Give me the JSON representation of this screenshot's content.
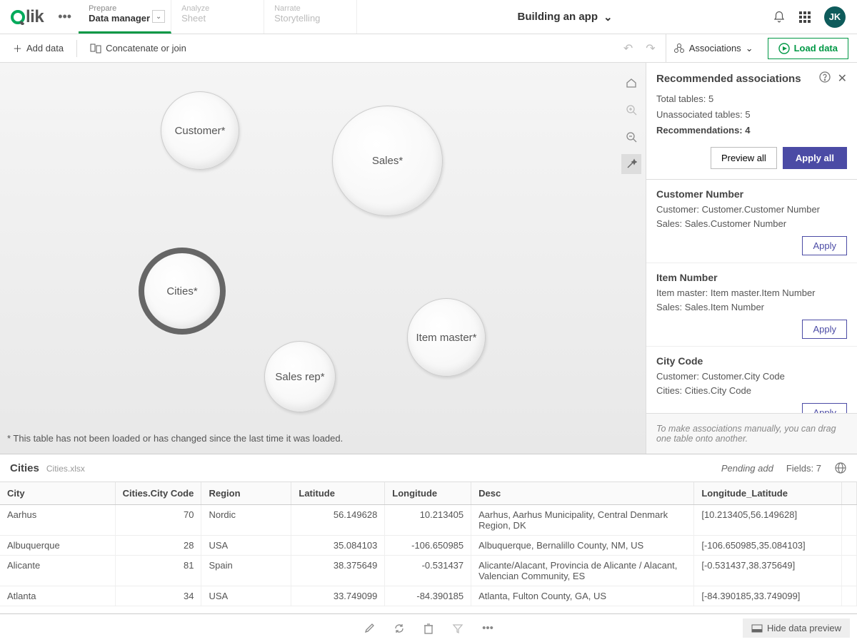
{
  "logo": {
    "q": "Q",
    "lik": "lik"
  },
  "avatar": "JK",
  "app_title": "Building an app",
  "tabs": [
    {
      "super": "Prepare",
      "main": "Data manager"
    },
    {
      "super": "Analyze",
      "main": "Sheet"
    },
    {
      "super": "Narrate",
      "main": "Storytelling"
    }
  ],
  "toolbar": {
    "add_data": "Add data",
    "concat": "Concatenate or join",
    "associations": "Associations",
    "load_data": "Load data"
  },
  "bubbles": {
    "customer": "Customer*",
    "sales": "Sales*",
    "cities": "Cities*",
    "item_master": "Item master*",
    "sales_rep": "Sales rep*"
  },
  "footnote": "* This table has not been loaded or has changed since the last time it was loaded.",
  "panel": {
    "title": "Recommended associations",
    "total_label": "Total tables:",
    "total_value": "5",
    "unassoc_label": "Unassociated tables:",
    "unassoc_value": "5",
    "rec_label": "Recommendations:",
    "rec_value": "4",
    "preview_all": "Preview all",
    "apply_all": "Apply all",
    "apply": "Apply",
    "recs": [
      {
        "name": "Customer Number",
        "line1": "Customer: Customer.Customer Number",
        "line2": "Sales: Sales.Customer Number"
      },
      {
        "name": "Item Number",
        "line1": "Item master: Item master.Item Number",
        "line2": "Sales: Sales.Item Number"
      },
      {
        "name": "City Code",
        "line1": "Customer: Customer.City Code",
        "line2": "Cities: Cities.City Code"
      }
    ],
    "footer": "To make associations manually, you can drag one table onto another."
  },
  "preview": {
    "title": "Cities",
    "file": "Cities.xlsx",
    "pending": "Pending add",
    "fields_label": "Fields:",
    "fields_count": "7",
    "columns": [
      "City",
      "Cities.City Code",
      "Region",
      "Latitude",
      "Longitude",
      "Desc",
      "Longitude_Latitude"
    ],
    "rows": [
      {
        "city": "Aarhus",
        "code": "70",
        "region": "Nordic",
        "lat": "56.149628",
        "lon": "10.213405",
        "desc": "Aarhus, Aarhus Municipality, Central Denmark Region, DK",
        "ll": "[10.213405,56.149628]"
      },
      {
        "city": "Albuquerque",
        "code": "28",
        "region": "USA",
        "lat": "35.084103",
        "lon": "-106.650985",
        "desc": "Albuquerque, Bernalillo County, NM, US",
        "ll": "[-106.650985,35.084103]"
      },
      {
        "city": "Alicante",
        "code": "81",
        "region": "Spain",
        "lat": "38.375649",
        "lon": "-0.531437",
        "desc": "Alicante/Alacant, Provincia de Alicante / Alacant, Valencian Community, ES",
        "ll": "[-0.531437,38.375649]"
      },
      {
        "city": "Atlanta",
        "code": "34",
        "region": "USA",
        "lat": "33.749099",
        "lon": "-84.390185",
        "desc": "Atlanta, Fulton County, GA, US",
        "ll": "[-84.390185,33.749099]"
      }
    ]
  },
  "bottom": {
    "hide_preview": "Hide data preview"
  }
}
